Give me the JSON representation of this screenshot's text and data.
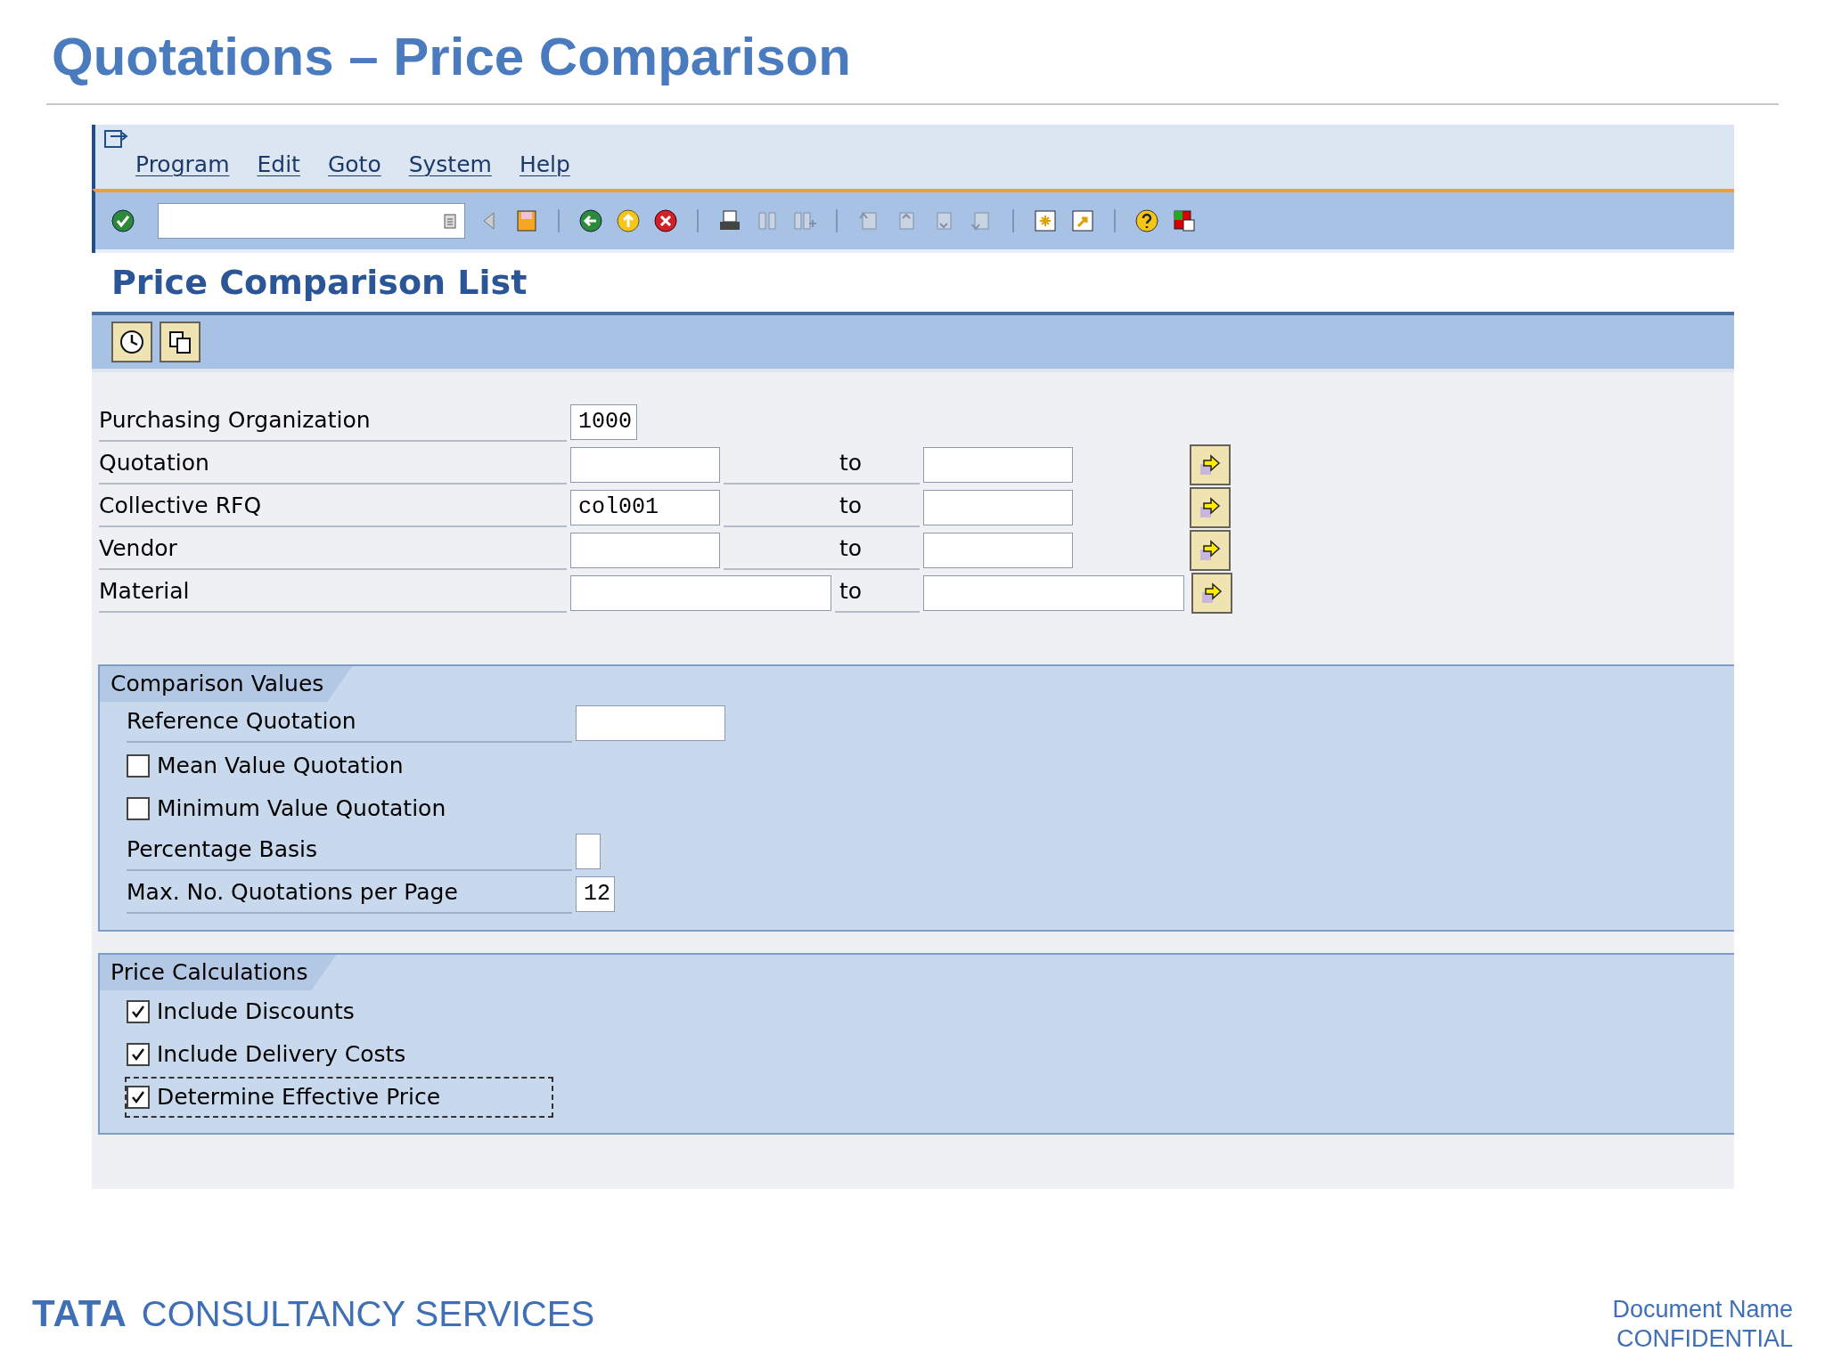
{
  "slide_title": "Quotations – Price Comparison",
  "menu": [
    {
      "label": "Program"
    },
    {
      "label": "Edit"
    },
    {
      "label": "Goto"
    },
    {
      "label": "System"
    },
    {
      "label": "Help"
    }
  ],
  "screen_title": "Price Comparison List",
  "selection": [
    {
      "kind": "single",
      "label": "Purchasing Organization",
      "value": "1000"
    },
    {
      "kind": "range",
      "label": "Quotation",
      "to_label": "to"
    },
    {
      "kind": "range",
      "label": "Collective RFQ",
      "value": "col001",
      "to_label": "to"
    },
    {
      "kind": "range",
      "label": "Vendor",
      "to_label": "to"
    },
    {
      "kind": "range_long",
      "label": "Material",
      "to_label": "to"
    }
  ],
  "groups": [
    {
      "title": "Comparison Values",
      "items": [
        {
          "kind": "text",
          "label": "Reference Quotation"
        },
        {
          "kind": "checkbox",
          "label": "Mean Value Quotation",
          "checked": false,
          "focused": false
        },
        {
          "kind": "checkbox",
          "label": "Minimum Value Quotation",
          "checked": false,
          "focused": false
        },
        {
          "kind": "flag",
          "label": "Percentage Basis"
        },
        {
          "kind": "number",
          "label": "Max. No. Quotations per Page",
          "value": "12"
        }
      ]
    },
    {
      "title": "Price Calculations",
      "items": [
        {
          "kind": "checkbox",
          "label": "Include Discounts",
          "checked": true,
          "focused": false
        },
        {
          "kind": "checkbox",
          "label": "Include Delivery Costs",
          "checked": true,
          "focused": false
        },
        {
          "kind": "checkbox",
          "label": "Determine Effective Price",
          "checked": true,
          "focused": true
        }
      ]
    }
  ],
  "footer": {
    "logo_mark": "TATA",
    "logo_text": "CONSULTANCY SERVICES",
    "doc_name": "Document Name",
    "confidential": "CONFIDENTIAL"
  }
}
